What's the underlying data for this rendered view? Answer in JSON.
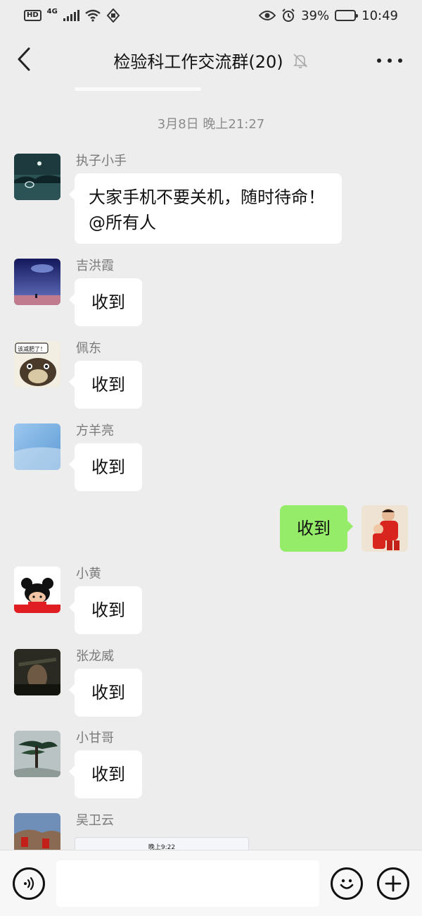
{
  "status_bar": {
    "hd": "HD",
    "network": "4G",
    "battery_text": "39%",
    "battery_level": 0.39,
    "time": "10:49"
  },
  "header": {
    "title": "检验科工作交流群(20)"
  },
  "chat": {
    "timestamp": "3月8日 晚上21:27",
    "messages": [
      {
        "sender": "执子小手",
        "text": "大家手机不要关机，随时待命！@所有人"
      },
      {
        "sender": "吉洪霞",
        "text": "收到"
      },
      {
        "sender": "佩东",
        "text": "收到",
        "avatar_caption": "该减肥了！"
      },
      {
        "sender": "方羊亮",
        "text": "收到"
      },
      {
        "sender": "self",
        "text": "收到"
      },
      {
        "sender": "小黄",
        "text": "收到"
      },
      {
        "sender": "张龙威",
        "text": "收到"
      },
      {
        "sender": "小甘哥",
        "text": "收到"
      },
      {
        "sender": "吴卫云",
        "image_caption": "晚上9:22"
      }
    ]
  },
  "input_bar": {
    "placeholder": ""
  },
  "icons": {
    "back": "chevron-left-icon",
    "mute": "bell-off-icon",
    "more": "more-dots-icon",
    "voice": "voice-icon",
    "emoji": "emoji-icon",
    "plus": "plus-icon"
  },
  "colors": {
    "background": "#ededed",
    "own_bubble": "#95ec69",
    "other_bubble": "#ffffff"
  }
}
